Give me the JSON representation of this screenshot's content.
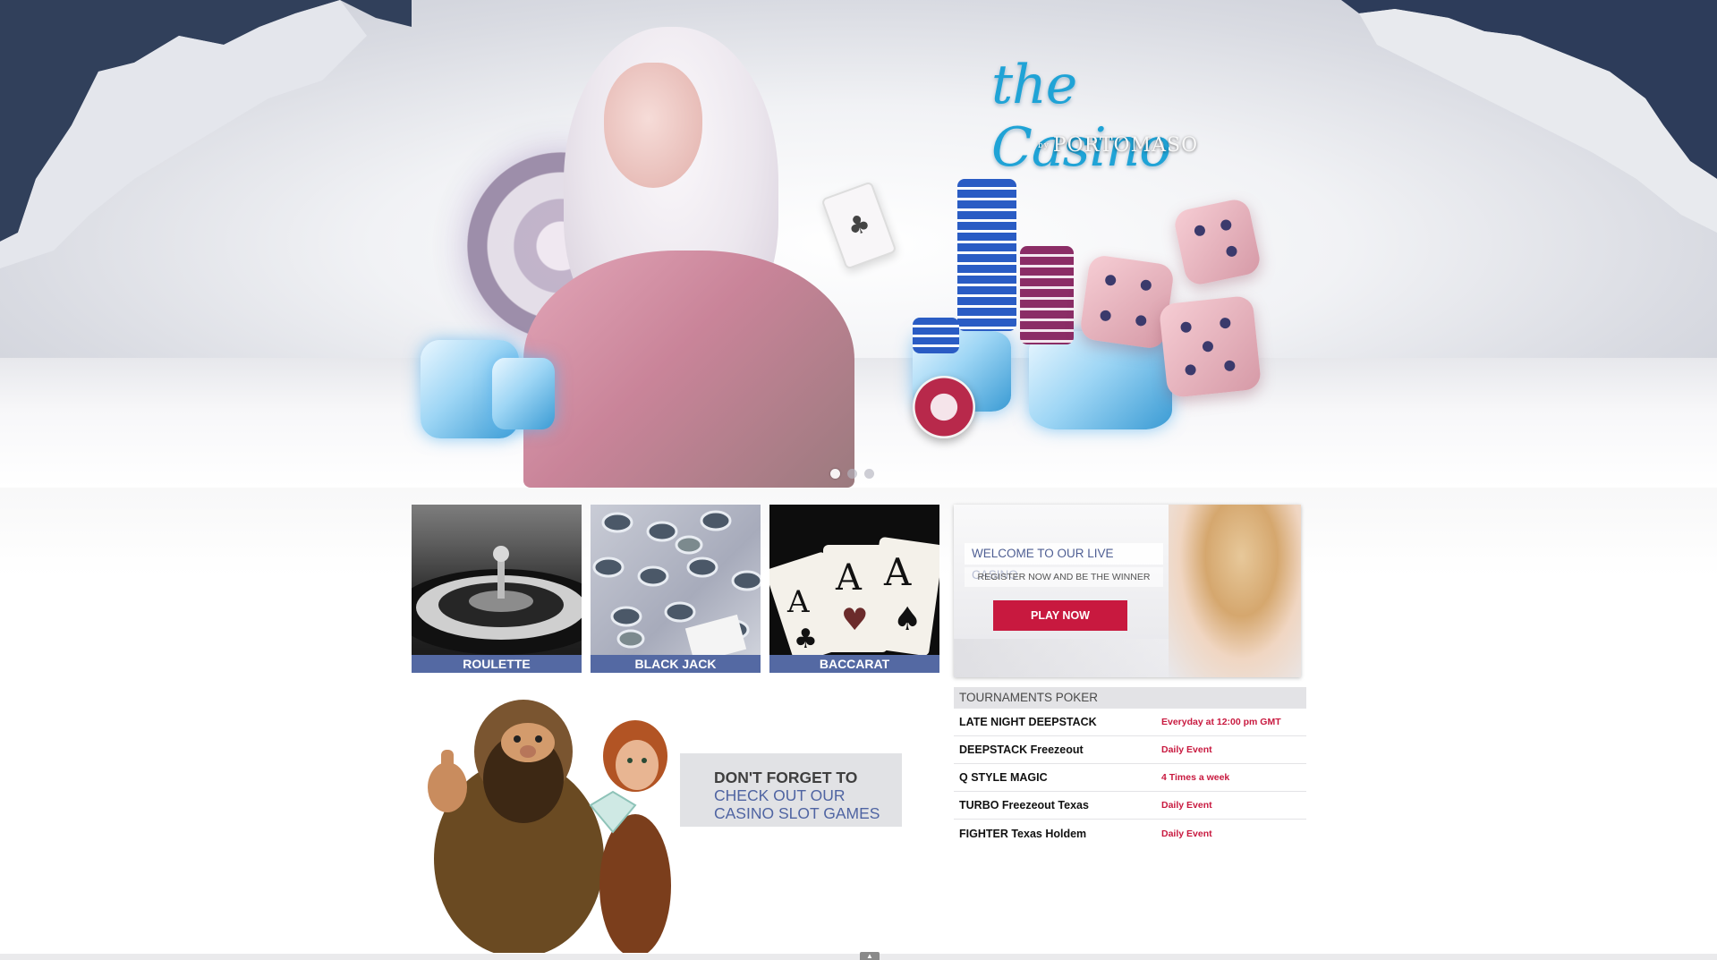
{
  "logo": {
    "script": "the Casino",
    "by": "by",
    "brand": "PORTOMASO"
  },
  "games": [
    {
      "label": "ROULETTE"
    },
    {
      "label": "BLACK JACK"
    },
    {
      "label": "BACCARAT"
    }
  ],
  "live_promo": {
    "title": "WELCOME TO OUR LIVE CASINO",
    "subtitle": "REGISTER NOW AND BE THE WINNER",
    "button": "PLAY NOW"
  },
  "slots_promo": {
    "line1": "DON'T FORGET TO",
    "line2": "CHECK OUT OUR",
    "line3": "CASINO SLOT GAMES"
  },
  "tournaments": {
    "header": "TOURNAMENTS POKER",
    "rows": [
      {
        "name": "LATE NIGHT DEEPSTACK",
        "when": "Everyday at 12:00 pm GMT"
      },
      {
        "name": "DEEPSTACK Freezeout",
        "when": "Daily Event"
      },
      {
        "name": "Q STYLE MAGIC",
        "when": "4 Times a week"
      },
      {
        "name": "TURBO Freezeout Texas",
        "when": "Daily Event"
      },
      {
        "name": "FIGHTER Texas Holdem",
        "when": "Daily Event"
      }
    ]
  },
  "slider": {
    "count": 3,
    "active_index": 0
  },
  "colors": {
    "accent_blue": "#5469a3",
    "accent_red": "#c8193f",
    "logo_blue": "#1fa3d6"
  }
}
